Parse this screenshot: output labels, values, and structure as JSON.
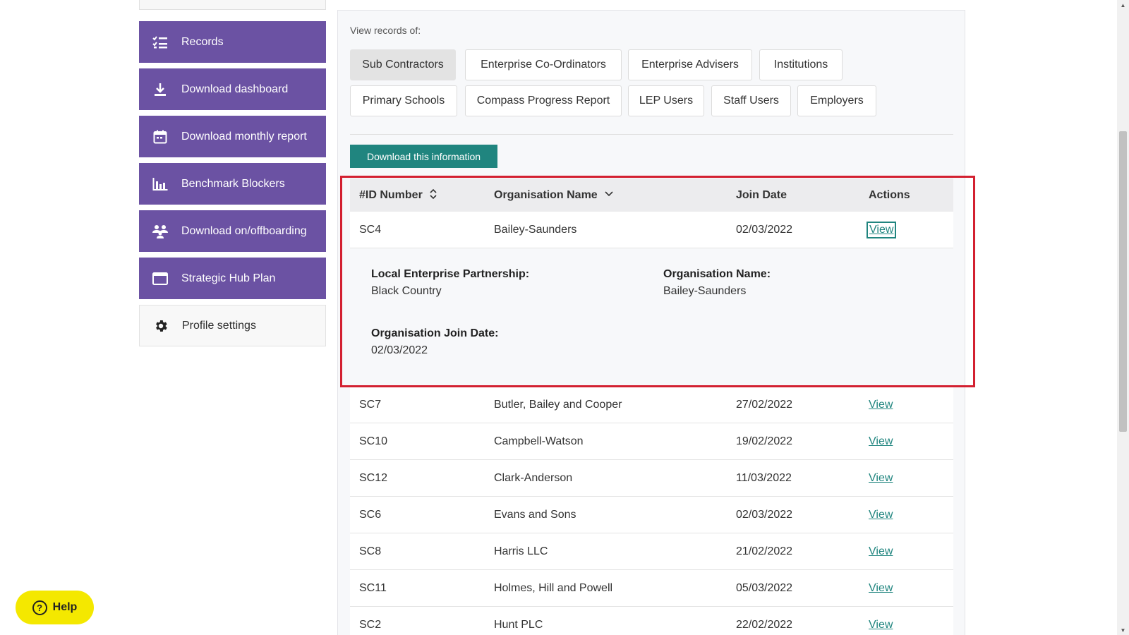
{
  "sidebar": {
    "items": [
      {
        "label": "Records",
        "icon": "records-list-icon"
      },
      {
        "label": "Download dashboard",
        "icon": "download-icon"
      },
      {
        "label": "Download monthly report",
        "icon": "calendar-icon"
      },
      {
        "label": "Benchmark Blockers",
        "icon": "bar-chart-icon"
      },
      {
        "label": "Download on/offboarding",
        "icon": "people-icon"
      },
      {
        "label": "Strategic Hub Plan",
        "icon": "window-icon"
      },
      {
        "label": "Profile settings",
        "icon": "gear-icon"
      }
    ]
  },
  "records": {
    "view_label": "View records of:",
    "tabs": [
      "Sub Contractors",
      "Enterprise Co-Ordinators",
      "Enterprise Advisers",
      "Institutions",
      "Primary Schools",
      "Compass Progress Report",
      "LEP Users",
      "Staff Users",
      "Employers"
    ],
    "active_tab": "Sub Contractors",
    "download_label": "Download this information"
  },
  "table": {
    "headers": {
      "id": "#ID Number",
      "org": "Organisation Name",
      "date": "Join Date",
      "actions": "Actions"
    },
    "expanded_row": {
      "id": "SC4",
      "org": "Bailey-Saunders",
      "date": "02/03/2022",
      "action": "View",
      "details": {
        "lep_label": "Local Enterprise Partnership:",
        "lep_value": "Black Country",
        "org_label": "Organisation Name:",
        "org_value": "Bailey-Saunders",
        "join_label": "Organisation Join Date:",
        "join_value": "02/03/2022"
      }
    },
    "rows": [
      {
        "id": "SC7",
        "org": "Butler, Bailey and Cooper",
        "date": "27/02/2022",
        "action": "View"
      },
      {
        "id": "SC10",
        "org": "Campbell-Watson",
        "date": "19/02/2022",
        "action": "View"
      },
      {
        "id": "SC12",
        "org": "Clark-Anderson",
        "date": "11/03/2022",
        "action": "View"
      },
      {
        "id": "SC6",
        "org": "Evans and Sons",
        "date": "02/03/2022",
        "action": "View"
      },
      {
        "id": "SC8",
        "org": "Harris LLC",
        "date": "21/02/2022",
        "action": "View"
      },
      {
        "id": "SC11",
        "org": "Holmes, Hill and Powell",
        "date": "05/03/2022",
        "action": "View"
      },
      {
        "id": "SC2",
        "org": "Hunt PLC",
        "date": "22/02/2022",
        "action": "View"
      }
    ]
  },
  "help": {
    "label": "Help",
    "icon": "question-circle-icon"
  },
  "colors": {
    "nav": "#6b52a3",
    "accent": "#20857f",
    "highlight": "#d32030",
    "help": "#f4e800"
  }
}
